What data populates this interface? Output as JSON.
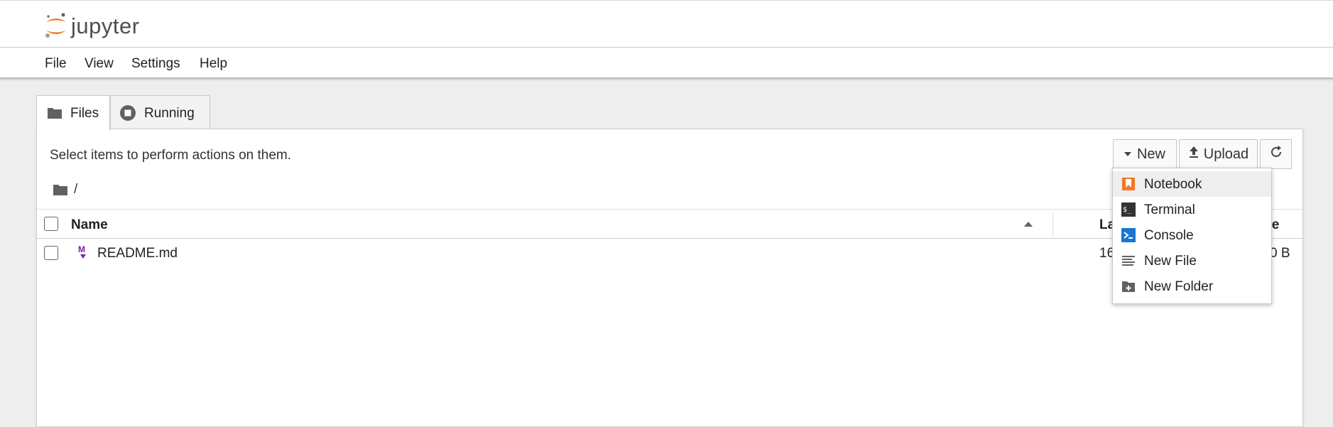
{
  "app": {
    "logo_text": "jupyter"
  },
  "menu": {
    "items": [
      "File",
      "View",
      "Settings",
      "Help"
    ]
  },
  "tabs": [
    {
      "label": "Files",
      "icon": "folder-icon",
      "active": true
    },
    {
      "label": "Running",
      "icon": "running-icon",
      "active": false
    }
  ],
  "panel": {
    "info_text": "Select items to perform actions on them.",
    "breadcrumb": "/",
    "toolbar": {
      "new_label": "New",
      "upload_label": "Upload",
      "refresh_icon": "refresh-icon"
    }
  },
  "list": {
    "headers": {
      "name": "Name",
      "modified": "La",
      "size": "ize"
    },
    "rows": [
      {
        "name": "README.md",
        "modified": "16",
        "size": "0 B",
        "icon": "markdown-icon"
      }
    ]
  },
  "new_menu": {
    "items": [
      {
        "label": "Notebook",
        "icon": "notebook-icon"
      },
      {
        "label": "Terminal",
        "icon": "terminal-icon"
      },
      {
        "label": "Console",
        "icon": "console-icon"
      },
      {
        "label": "New File",
        "icon": "text-file-icon"
      },
      {
        "label": "New Folder",
        "icon": "new-folder-icon"
      }
    ],
    "highlighted_index": 0
  },
  "colors": {
    "accent_orange": "#f37726",
    "markdown_purple": "#7b1fa2",
    "console_blue": "#1976d2",
    "page_bg": "#eeeeee"
  }
}
